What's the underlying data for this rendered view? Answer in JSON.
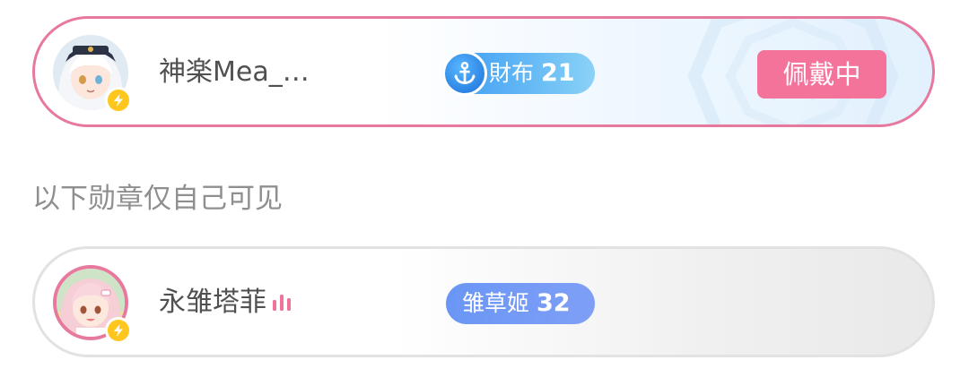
{
  "worn_card": {
    "username": "神楽Mea_…",
    "avatar_icon": "anime-girl-avatar-icon",
    "badge_icon": "lightning-icon",
    "medal": {
      "name": "財布",
      "level": "21",
      "icon": "anchor-icon",
      "color": "#3d9bf2"
    },
    "status_button": "佩戴中",
    "status_color": "#f4739a",
    "border_color": "#e8799e"
  },
  "section": {
    "title": "以下勋章仅自己可见"
  },
  "hidden_card": {
    "username": "永雏塔菲",
    "avatar_icon": "anime-girl-avatar-icon",
    "badge_icon": "lightning-icon",
    "live_icon": "live-signal-icon",
    "medal": {
      "name": "雏草姬",
      "level": "32",
      "color": "#6a96f5"
    },
    "border_color": "#e2e2e2"
  }
}
